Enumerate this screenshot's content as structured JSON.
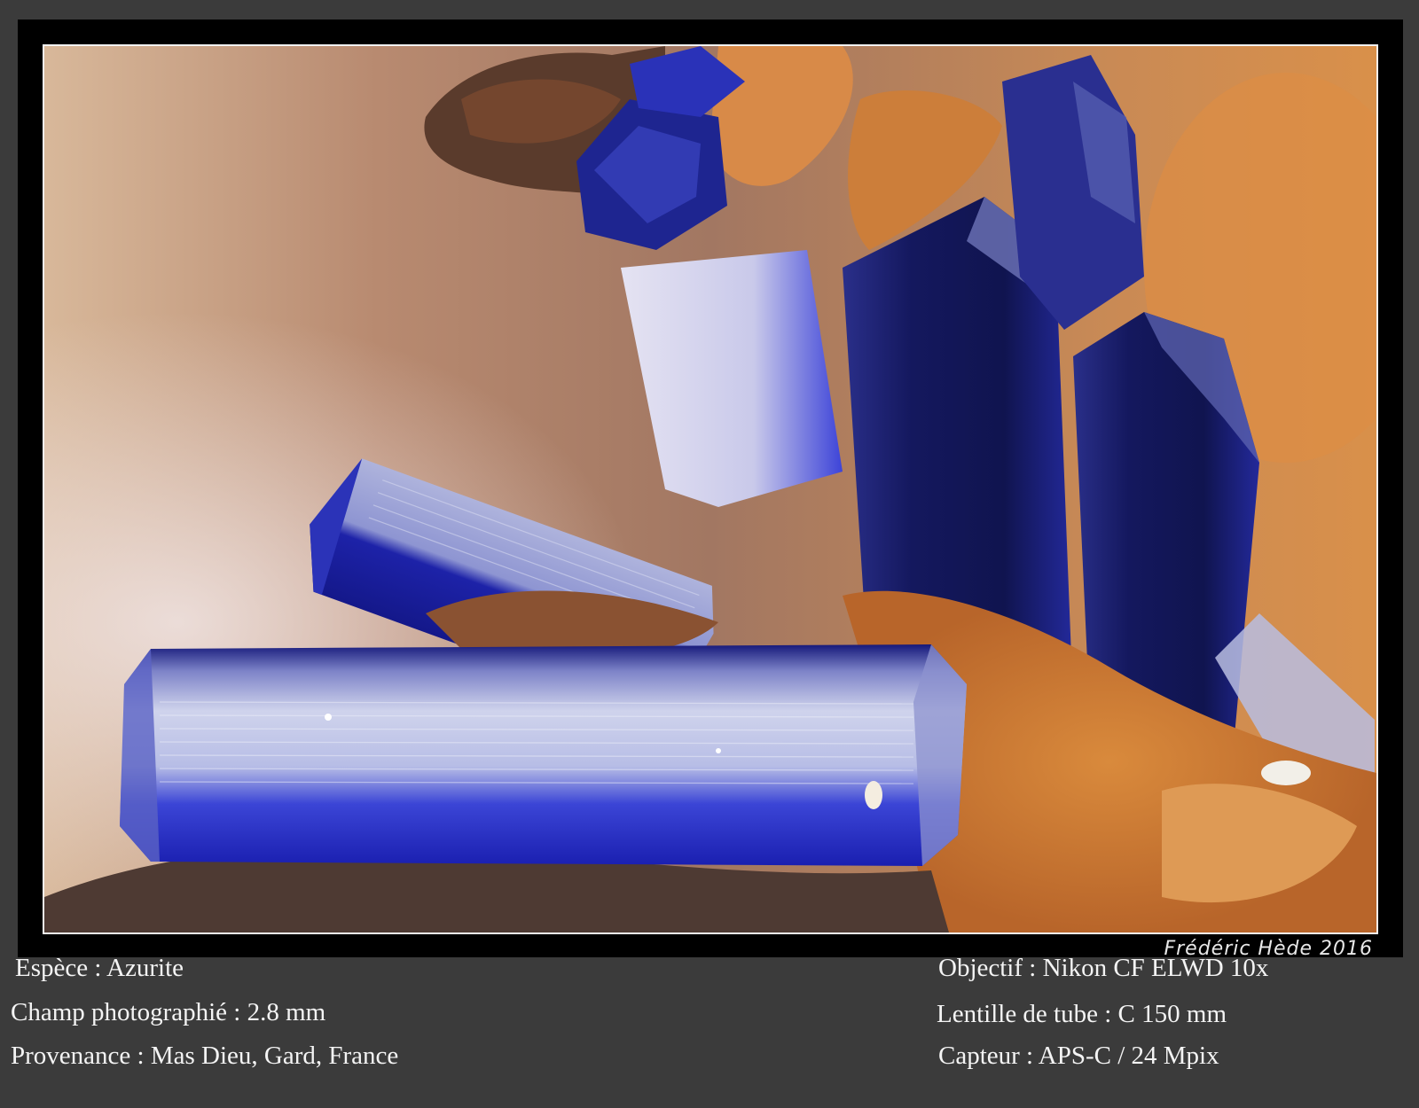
{
  "signature": "Frédéric Hède 2016",
  "left_info": [
    "Espèce : Azurite",
    "Champ photographié : 2.8 mm",
    "Provenance : Mas Dieu, Gard, France"
  ],
  "right_info": [
    "Objectif : Nikon CF ELWD 10x",
    "Lentille de tube : C 150 mm",
    "Capteur : APS-C / 24 Mpix"
  ],
  "colors": {
    "page_background": "#3b3b3b",
    "frame": "#000000",
    "photo_border": "#f2f2f2",
    "azurite_blue": "#1a1fb0",
    "matrix_orange": "#c8702a"
  }
}
